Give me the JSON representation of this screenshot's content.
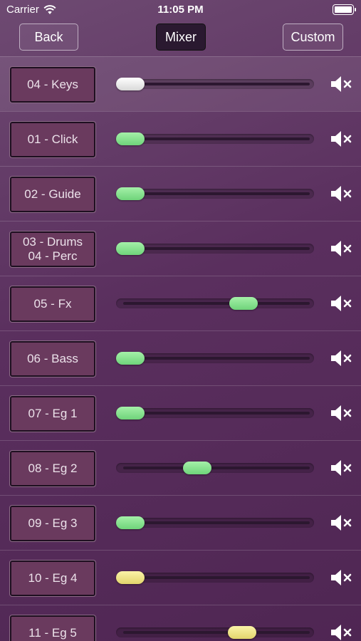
{
  "status": {
    "carrier": "Carrier",
    "time": "11:05 PM"
  },
  "nav": {
    "back": "Back",
    "title": "Mixer",
    "custom": "Custom"
  },
  "colors": {
    "background": "#5a2f5e",
    "thumb_green": "#7fdc88",
    "thumb_yellow": "#efe38a",
    "thumb_white": "#f0f0f0"
  },
  "tracks": [
    {
      "lines": [
        "04 - Keys"
      ],
      "level": 0.0,
      "thumb": "white"
    },
    {
      "lines": [
        "01 - Click"
      ],
      "level": 0.0,
      "thumb": "green"
    },
    {
      "lines": [
        "02 - Guide"
      ],
      "level": 0.0,
      "thumb": "green"
    },
    {
      "lines": [
        "03 - Drums",
        "04 - Perc"
      ],
      "level": 0.0,
      "thumb": "green"
    },
    {
      "lines": [
        "05 - Fx"
      ],
      "level": 0.68,
      "thumb": "green"
    },
    {
      "lines": [
        "06 - Bass"
      ],
      "level": 0.0,
      "thumb": "green"
    },
    {
      "lines": [
        "07 - Eg 1"
      ],
      "level": 0.0,
      "thumb": "green"
    },
    {
      "lines": [
        "08 - Eg 2"
      ],
      "level": 0.4,
      "thumb": "green"
    },
    {
      "lines": [
        "09 - Eg 3"
      ],
      "level": 0.0,
      "thumb": "green"
    },
    {
      "lines": [
        "10 - Eg 4"
      ],
      "level": 0.0,
      "thumb": "yellow"
    },
    {
      "lines": [
        "11 - Eg 5"
      ],
      "level": 0.67,
      "thumb": "yellow"
    }
  ],
  "icons": {
    "wifi": "wifi-icon",
    "battery": "battery-icon",
    "mute": "speaker-mute-icon"
  }
}
